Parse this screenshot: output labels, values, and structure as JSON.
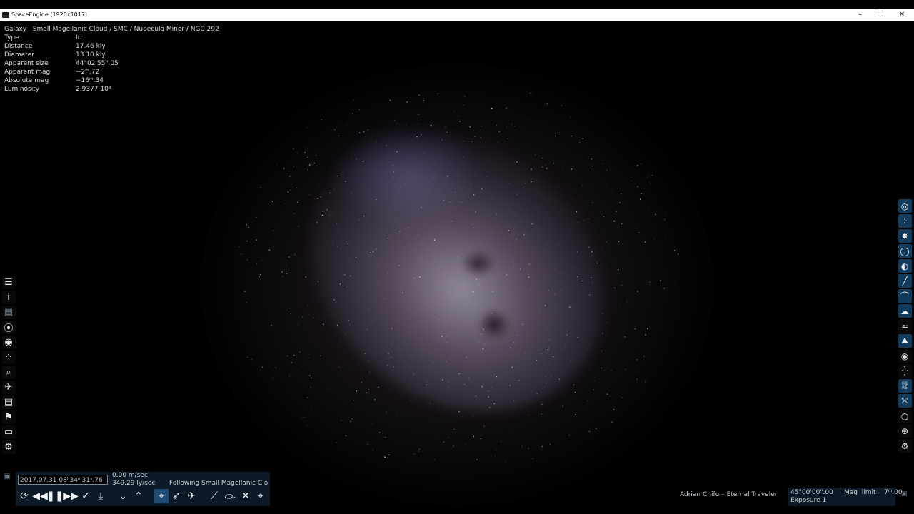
{
  "window": {
    "title": "SpaceEngine (1920x1017)",
    "minimize": "–",
    "restore": "❐",
    "close": "✕"
  },
  "info": {
    "path": "Galaxy   Small Magellanic Cloud / SMC / Nubecula Minor / NGC 292",
    "rows": [
      {
        "key": "Type",
        "value": "Irr"
      },
      {
        "key": "Distance",
        "value": "17.46 kly"
      },
      {
        "key": "Diameter",
        "value": "13.10 kly"
      },
      {
        "key": "Apparent size",
        "value": "44°02'55\".05"
      },
      {
        "key": "Apparent mag",
        "value": "−2ᵐ.72"
      },
      {
        "key": "Absolute mag",
        "value": "−16ᵐ.34"
      },
      {
        "key": "Luminosity",
        "value": "2.9377·10⁸"
      }
    ]
  },
  "left_toolbar": [
    {
      "name": "menu-icon",
      "glyph": "☰"
    },
    {
      "name": "info-icon",
      "glyph": "i"
    },
    {
      "name": "planetarium-icon",
      "glyph": "▦",
      "dim": true
    },
    {
      "name": "orbit-icon",
      "glyph": "⦿"
    },
    {
      "name": "eyes-icon",
      "glyph": "◉"
    },
    {
      "name": "stars-icon",
      "glyph": "⁘"
    },
    {
      "name": "search-icon",
      "glyph": "⌕"
    },
    {
      "name": "ship-icon",
      "glyph": "✈"
    },
    {
      "name": "calendar-icon",
      "glyph": "▤"
    },
    {
      "name": "flag-icon",
      "glyph": "⚑"
    },
    {
      "name": "screen-icon",
      "glyph": "▭"
    },
    {
      "name": "gear-icon",
      "glyph": "⚙"
    }
  ],
  "right_toolbar": [
    {
      "name": "galaxy-icon",
      "glyph": "◎",
      "blue": true
    },
    {
      "name": "cluster-icon",
      "glyph": "⁘",
      "blue": true
    },
    {
      "name": "star-icon",
      "glyph": "✸",
      "blue": true
    },
    {
      "name": "ring-icon",
      "glyph": "◯",
      "blue": true
    },
    {
      "name": "planet-icon",
      "glyph": "◐",
      "blue": true
    },
    {
      "name": "comet-icon",
      "glyph": "╱",
      "blue": true
    },
    {
      "name": "arc-icon",
      "glyph": "⌒",
      "blue": true
    },
    {
      "name": "cloud-icon",
      "glyph": "☁",
      "blue": true
    },
    {
      "name": "water-icon",
      "glyph": "≈",
      "blue": false
    },
    {
      "name": "landscape-icon",
      "glyph": "⛰",
      "blue": true
    },
    {
      "name": "eye-icon",
      "glyph": "◉",
      "blue": false
    },
    {
      "name": "dots-icon",
      "glyph": "⁛",
      "blue": false
    },
    {
      "name": "labels-icon",
      "glyph": "•",
      "blue": true
    },
    {
      "name": "expand-icon",
      "glyph": "⤧",
      "blue": true
    },
    {
      "name": "circle-icon",
      "glyph": "○",
      "blue": false
    },
    {
      "name": "globe-icon",
      "glyph": "⊕",
      "blue": false
    },
    {
      "name": "gear-icon",
      "glyph": "⚙",
      "blue": false
    }
  ],
  "right_toolbar_labels": [
    "R8",
    "R5"
  ],
  "bottom_bar": {
    "date": "2017.07.31  08ʰ34ᵐ31ˢ.76",
    "speed_ms": "0.00  m/sec",
    "speed_lys": "349.29  ly/sec",
    "following": "Following  Small  Magellanic  Clo",
    "controls": [
      {
        "name": "sync-icon",
        "glyph": "⟳"
      },
      {
        "name": "rewind-icon",
        "glyph": "◀◀"
      },
      {
        "name": "pause-icon",
        "glyph": "❚❚"
      },
      {
        "name": "forward-icon",
        "glyph": "▶▶"
      },
      {
        "name": "check-icon",
        "glyph": "✓"
      },
      {
        "name": "land-icon",
        "glyph": "⤓"
      },
      {
        "name": "down-icon",
        "glyph": "⌄"
      },
      {
        "name": "up-icon",
        "glyph": "⌃"
      },
      {
        "name": "select-icon",
        "glyph": "⌖",
        "hl": true
      },
      {
        "name": "rocket-icon",
        "glyph": "➶"
      },
      {
        "name": "plane-icon",
        "glyph": "✈"
      },
      {
        "name": "telescope-icon",
        "glyph": "⟋"
      },
      {
        "name": "camera-icon",
        "glyph": "⤼"
      },
      {
        "name": "close-x-icon",
        "glyph": "✕"
      },
      {
        "name": "crosshair-icon",
        "glyph": "⌖"
      }
    ]
  },
  "status": {
    "credit": "Adrian  Chifu  –  Eternal  Traveler",
    "fov": "45°00'00\".00",
    "exposure": "Exposure  1",
    "mag_limit": "Mag  limit    7ᵐ.00"
  }
}
